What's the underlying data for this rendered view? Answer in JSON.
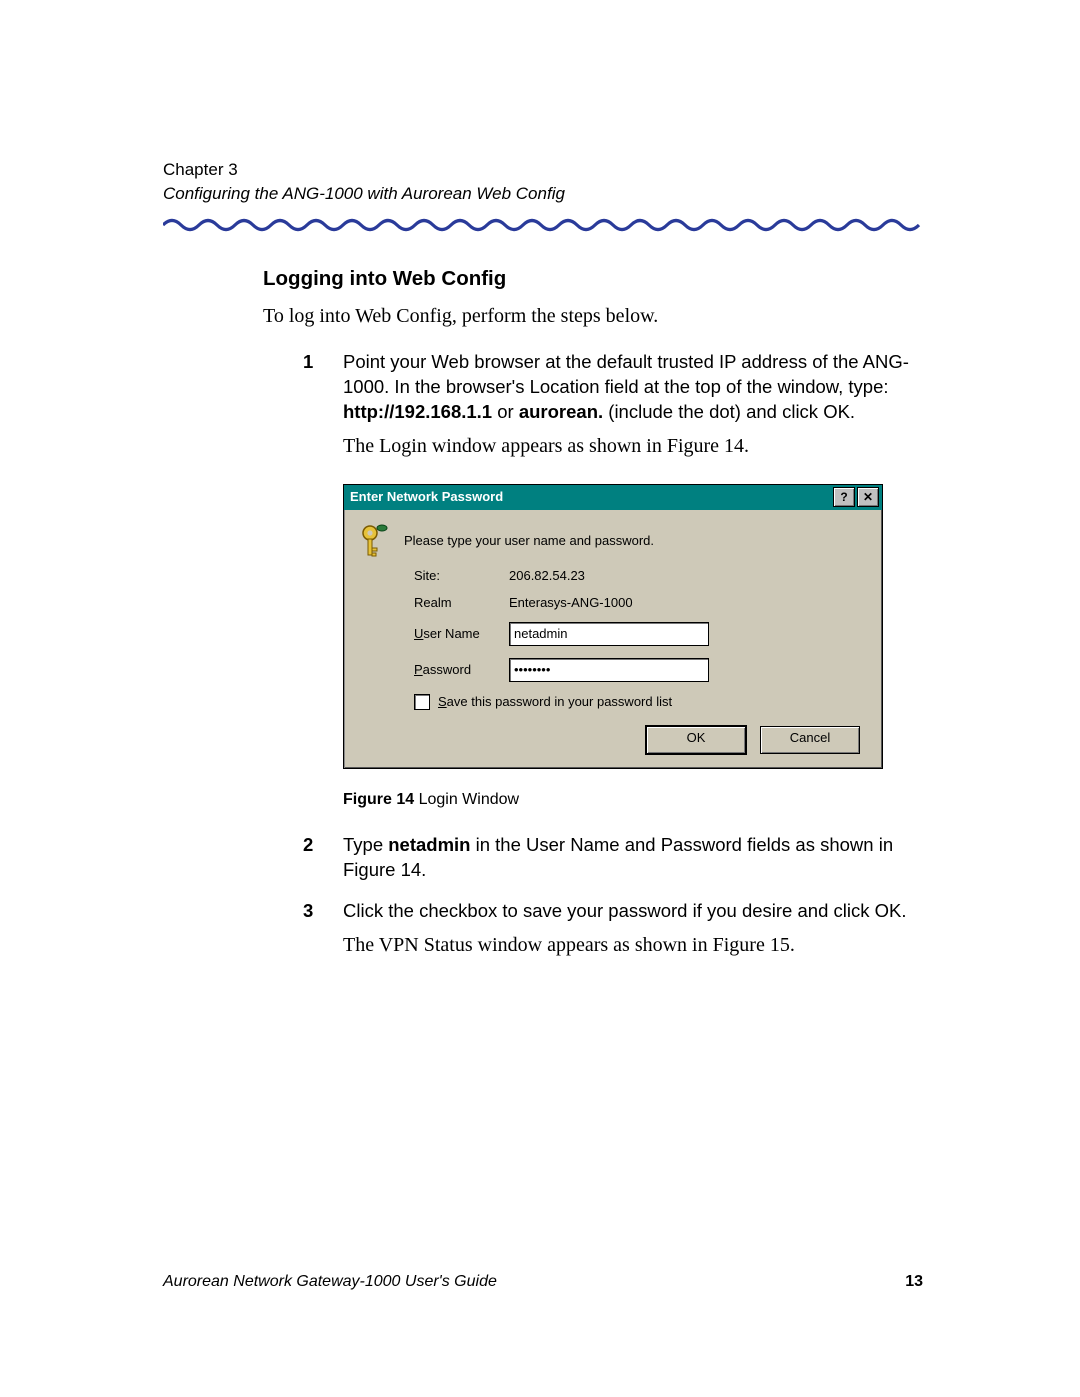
{
  "header": {
    "chapter": "Chapter 3",
    "subtitle": "Configuring the ANG-1000 with Aurorean Web Config"
  },
  "section_title": "Logging into Web Config",
  "intro": "To log into Web Config, perform the steps below.",
  "steps": {
    "s1": {
      "num": "1",
      "text_a": "Point your Web browser at the default trusted IP address of the ANG-1000. In the browser's Location field at the top of the window, type: ",
      "bold_a": "http://192.168.1.1 ",
      "text_b": "or ",
      "bold_b": "aurorean.",
      "text_c": " (include the dot) and click OK.",
      "serif_line": "The Login window appears as shown in Figure 14."
    },
    "s2": {
      "num": "2",
      "text_a": "Type ",
      "bold_a": "netadmin",
      "text_b": " in the User Name and Password fields as shown in Figure 14."
    },
    "s3": {
      "num": "3",
      "text": "Click the checkbox to save your password if you desire and click OK.",
      "serif_line": "The VPN Status window appears as shown in Figure 15."
    }
  },
  "dialog": {
    "title": "Enter Network Password",
    "help_btn": "?",
    "close_btn": "✕",
    "prompt": "Please type your user name and password.",
    "site_label": "Site:",
    "site_value": "206.82.54.23",
    "realm_label": "Realm",
    "realm_value": "Enterasys-ANG-1000",
    "user_label": "User Name",
    "user_value": "netadmin",
    "pass_label": "Password",
    "pass_value": "••••••••",
    "save_label": "Save this password in your password list",
    "ok": "OK",
    "cancel": "Cancel"
  },
  "caption": {
    "bold": "Figure 14",
    "rest": "   Login Window"
  },
  "footer": {
    "guide": "Aurorean Network Gateway-1000 User's Guide",
    "page": "13"
  }
}
